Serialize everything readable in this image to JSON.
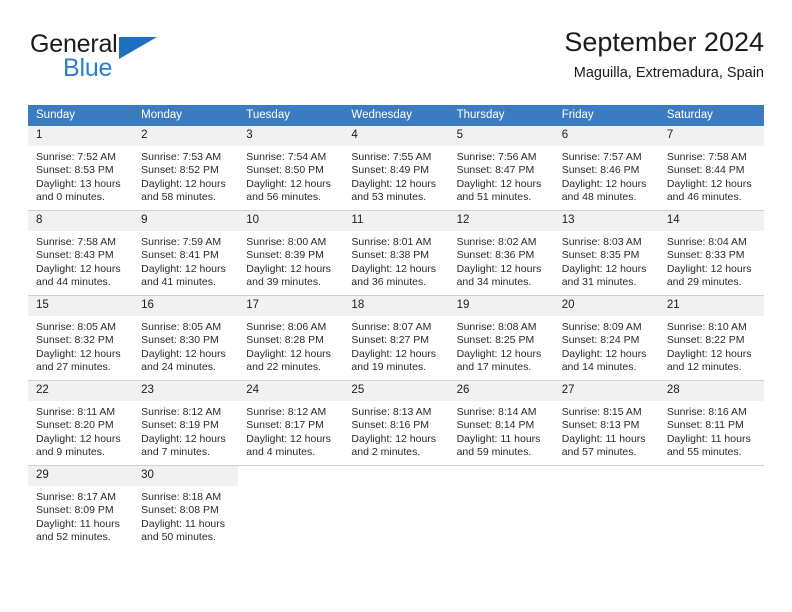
{
  "brand": {
    "name_top": "General",
    "name_bottom": "Blue",
    "accent_color": "#2a7fd4",
    "triangle_color": "#1f6fc0"
  },
  "header": {
    "title": "September 2024",
    "subtitle": "Maguilla, Extremadura, Spain",
    "header_bg": "#3b7cc0",
    "daynum_bg": "#f1f1f1"
  },
  "weekday_headers": [
    "Sunday",
    "Monday",
    "Tuesday",
    "Wednesday",
    "Thursday",
    "Friday",
    "Saturday"
  ],
  "weeks": [
    [
      {
        "day": "1",
        "sunrise": "Sunrise: 7:52 AM",
        "sunset": "Sunset: 8:53 PM",
        "daylight_line1": "Daylight: 13 hours",
        "daylight_line2": "and 0 minutes."
      },
      {
        "day": "2",
        "sunrise": "Sunrise: 7:53 AM",
        "sunset": "Sunset: 8:52 PM",
        "daylight_line1": "Daylight: 12 hours",
        "daylight_line2": "and 58 minutes."
      },
      {
        "day": "3",
        "sunrise": "Sunrise: 7:54 AM",
        "sunset": "Sunset: 8:50 PM",
        "daylight_line1": "Daylight: 12 hours",
        "daylight_line2": "and 56 minutes."
      },
      {
        "day": "4",
        "sunrise": "Sunrise: 7:55 AM",
        "sunset": "Sunset: 8:49 PM",
        "daylight_line1": "Daylight: 12 hours",
        "daylight_line2": "and 53 minutes."
      },
      {
        "day": "5",
        "sunrise": "Sunrise: 7:56 AM",
        "sunset": "Sunset: 8:47 PM",
        "daylight_line1": "Daylight: 12 hours",
        "daylight_line2": "and 51 minutes."
      },
      {
        "day": "6",
        "sunrise": "Sunrise: 7:57 AM",
        "sunset": "Sunset: 8:46 PM",
        "daylight_line1": "Daylight: 12 hours",
        "daylight_line2": "and 48 minutes."
      },
      {
        "day": "7",
        "sunrise": "Sunrise: 7:58 AM",
        "sunset": "Sunset: 8:44 PM",
        "daylight_line1": "Daylight: 12 hours",
        "daylight_line2": "and 46 minutes."
      }
    ],
    [
      {
        "day": "8",
        "sunrise": "Sunrise: 7:58 AM",
        "sunset": "Sunset: 8:43 PM",
        "daylight_line1": "Daylight: 12 hours",
        "daylight_line2": "and 44 minutes."
      },
      {
        "day": "9",
        "sunrise": "Sunrise: 7:59 AM",
        "sunset": "Sunset: 8:41 PM",
        "daylight_line1": "Daylight: 12 hours",
        "daylight_line2": "and 41 minutes."
      },
      {
        "day": "10",
        "sunrise": "Sunrise: 8:00 AM",
        "sunset": "Sunset: 8:39 PM",
        "daylight_line1": "Daylight: 12 hours",
        "daylight_line2": "and 39 minutes."
      },
      {
        "day": "11",
        "sunrise": "Sunrise: 8:01 AM",
        "sunset": "Sunset: 8:38 PM",
        "daylight_line1": "Daylight: 12 hours",
        "daylight_line2": "and 36 minutes."
      },
      {
        "day": "12",
        "sunrise": "Sunrise: 8:02 AM",
        "sunset": "Sunset: 8:36 PM",
        "daylight_line1": "Daylight: 12 hours",
        "daylight_line2": "and 34 minutes."
      },
      {
        "day": "13",
        "sunrise": "Sunrise: 8:03 AM",
        "sunset": "Sunset: 8:35 PM",
        "daylight_line1": "Daylight: 12 hours",
        "daylight_line2": "and 31 minutes."
      },
      {
        "day": "14",
        "sunrise": "Sunrise: 8:04 AM",
        "sunset": "Sunset: 8:33 PM",
        "daylight_line1": "Daylight: 12 hours",
        "daylight_line2": "and 29 minutes."
      }
    ],
    [
      {
        "day": "15",
        "sunrise": "Sunrise: 8:05 AM",
        "sunset": "Sunset: 8:32 PM",
        "daylight_line1": "Daylight: 12 hours",
        "daylight_line2": "and 27 minutes."
      },
      {
        "day": "16",
        "sunrise": "Sunrise: 8:05 AM",
        "sunset": "Sunset: 8:30 PM",
        "daylight_line1": "Daylight: 12 hours",
        "daylight_line2": "and 24 minutes."
      },
      {
        "day": "17",
        "sunrise": "Sunrise: 8:06 AM",
        "sunset": "Sunset: 8:28 PM",
        "daylight_line1": "Daylight: 12 hours",
        "daylight_line2": "and 22 minutes."
      },
      {
        "day": "18",
        "sunrise": "Sunrise: 8:07 AM",
        "sunset": "Sunset: 8:27 PM",
        "daylight_line1": "Daylight: 12 hours",
        "daylight_line2": "and 19 minutes."
      },
      {
        "day": "19",
        "sunrise": "Sunrise: 8:08 AM",
        "sunset": "Sunset: 8:25 PM",
        "daylight_line1": "Daylight: 12 hours",
        "daylight_line2": "and 17 minutes."
      },
      {
        "day": "20",
        "sunrise": "Sunrise: 8:09 AM",
        "sunset": "Sunset: 8:24 PM",
        "daylight_line1": "Daylight: 12 hours",
        "daylight_line2": "and 14 minutes."
      },
      {
        "day": "21",
        "sunrise": "Sunrise: 8:10 AM",
        "sunset": "Sunset: 8:22 PM",
        "daylight_line1": "Daylight: 12 hours",
        "daylight_line2": "and 12 minutes."
      }
    ],
    [
      {
        "day": "22",
        "sunrise": "Sunrise: 8:11 AM",
        "sunset": "Sunset: 8:20 PM",
        "daylight_line1": "Daylight: 12 hours",
        "daylight_line2": "and 9 minutes."
      },
      {
        "day": "23",
        "sunrise": "Sunrise: 8:12 AM",
        "sunset": "Sunset: 8:19 PM",
        "daylight_line1": "Daylight: 12 hours",
        "daylight_line2": "and 7 minutes."
      },
      {
        "day": "24",
        "sunrise": "Sunrise: 8:12 AM",
        "sunset": "Sunset: 8:17 PM",
        "daylight_line1": "Daylight: 12 hours",
        "daylight_line2": "and 4 minutes."
      },
      {
        "day": "25",
        "sunrise": "Sunrise: 8:13 AM",
        "sunset": "Sunset: 8:16 PM",
        "daylight_line1": "Daylight: 12 hours",
        "daylight_line2": "and 2 minutes."
      },
      {
        "day": "26",
        "sunrise": "Sunrise: 8:14 AM",
        "sunset": "Sunset: 8:14 PM",
        "daylight_line1": "Daylight: 11 hours",
        "daylight_line2": "and 59 minutes."
      },
      {
        "day": "27",
        "sunrise": "Sunrise: 8:15 AM",
        "sunset": "Sunset: 8:13 PM",
        "daylight_line1": "Daylight: 11 hours",
        "daylight_line2": "and 57 minutes."
      },
      {
        "day": "28",
        "sunrise": "Sunrise: 8:16 AM",
        "sunset": "Sunset: 8:11 PM",
        "daylight_line1": "Daylight: 11 hours",
        "daylight_line2": "and 55 minutes."
      }
    ],
    [
      {
        "day": "29",
        "sunrise": "Sunrise: 8:17 AM",
        "sunset": "Sunset: 8:09 PM",
        "daylight_line1": "Daylight: 11 hours",
        "daylight_line2": "and 52 minutes."
      },
      {
        "day": "30",
        "sunrise": "Sunrise: 8:18 AM",
        "sunset": "Sunset: 8:08 PM",
        "daylight_line1": "Daylight: 11 hours",
        "daylight_line2": "and 50 minutes."
      },
      {
        "day": "",
        "sunrise": "",
        "sunset": "",
        "daylight_line1": "",
        "daylight_line2": ""
      },
      {
        "day": "",
        "sunrise": "",
        "sunset": "",
        "daylight_line1": "",
        "daylight_line2": ""
      },
      {
        "day": "",
        "sunrise": "",
        "sunset": "",
        "daylight_line1": "",
        "daylight_line2": ""
      },
      {
        "day": "",
        "sunrise": "",
        "sunset": "",
        "daylight_line1": "",
        "daylight_line2": ""
      },
      {
        "day": "",
        "sunrise": "",
        "sunset": "",
        "daylight_line1": "",
        "daylight_line2": ""
      }
    ]
  ]
}
